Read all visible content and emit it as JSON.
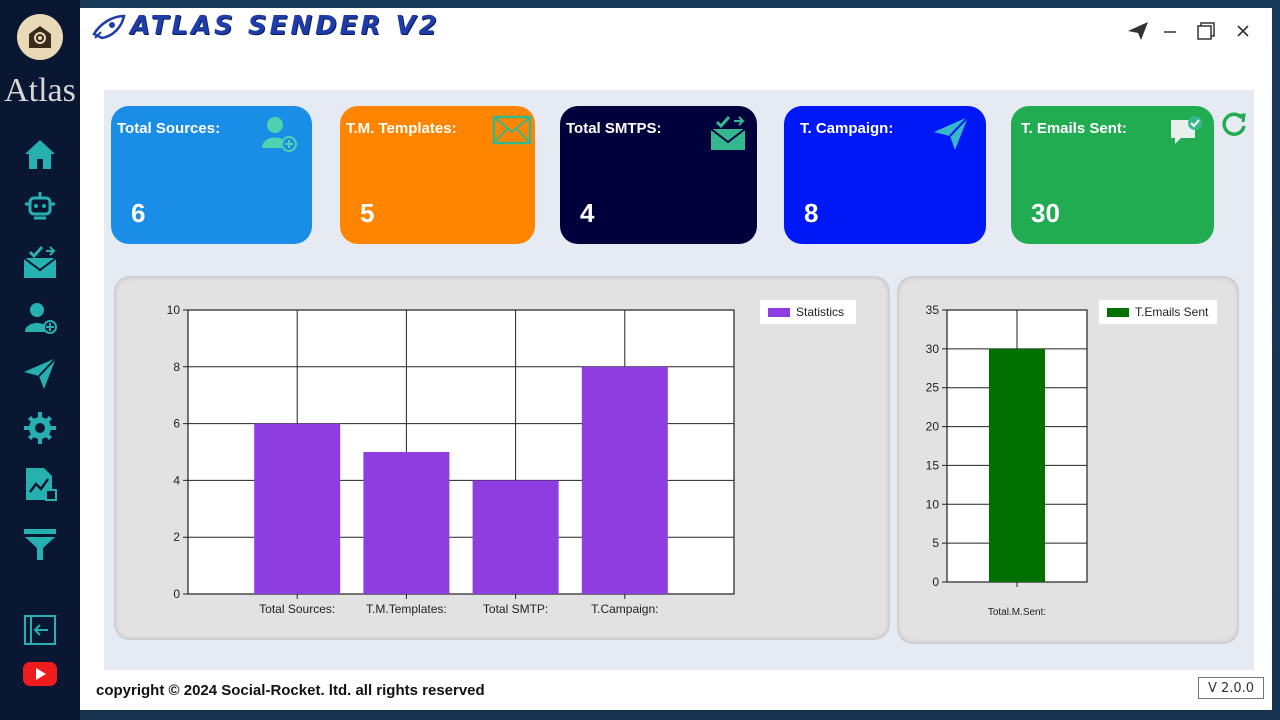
{
  "app": {
    "logo_text": "Atlas",
    "title": "ATLAS SENDER V2",
    "footer": "copyright © 2024 Social-Rocket. ltd. all rights reserved",
    "version": "V 2.0.0"
  },
  "sidebar": {
    "items": [
      {
        "name": "home",
        "icon": "home-icon"
      },
      {
        "name": "senders",
        "icon": "robot-icon"
      },
      {
        "name": "templates",
        "icon": "mail-check-icon"
      },
      {
        "name": "sources",
        "icon": "add-user-icon"
      },
      {
        "name": "campaign",
        "icon": "paper-plane-icon"
      },
      {
        "name": "settings",
        "icon": "gear-icon"
      },
      {
        "name": "reports",
        "icon": "chart-doc-icon"
      },
      {
        "name": "filter",
        "icon": "filter-icon"
      },
      {
        "name": "logout",
        "icon": "logout-icon"
      },
      {
        "name": "youtube",
        "icon": "youtube-icon"
      }
    ]
  },
  "cards": [
    {
      "title": "Total Sources:",
      "value": "6",
      "color": "#1a8ee6",
      "icon": "add-user-icon"
    },
    {
      "title": "T.M. Templates:",
      "value": "5",
      "color": "#ff8400",
      "icon": "envelope-icon"
    },
    {
      "title": "Total SMTPS:",
      "value": "4",
      "color": "#00003d",
      "icon": "mail-check-icon"
    },
    {
      "title": "T. Campaign:",
      "value": "8",
      "color": "#0018f5",
      "icon": "paper-plane-icon"
    },
    {
      "title": "T. Emails Sent:",
      "value": "30",
      "color": "#22ac52",
      "icon": "chat-check-icon"
    }
  ],
  "chart_data": [
    {
      "type": "bar",
      "categories": [
        "Total Sources:",
        "T.M.Templates:",
        "Total SMTP:",
        "T.Campaign:"
      ],
      "series": [
        {
          "name": "Statistics",
          "values": [
            6,
            5,
            4,
            8
          ],
          "color": "#8e3ee0"
        }
      ],
      "ylim": [
        0,
        10
      ],
      "yticks": [
        0,
        2,
        4,
        6,
        8,
        10
      ],
      "grid": true,
      "legend": "top-right"
    },
    {
      "type": "bar",
      "categories": [
        "Total.M.Sent:"
      ],
      "series": [
        {
          "name": "T.Emails Sent",
          "values": [
            30
          ],
          "color": "#007000"
        }
      ],
      "ylim": [
        0,
        35
      ],
      "yticks": [
        0,
        5,
        10,
        15,
        20,
        25,
        30,
        35
      ],
      "grid": true,
      "legend": "top-right"
    }
  ]
}
